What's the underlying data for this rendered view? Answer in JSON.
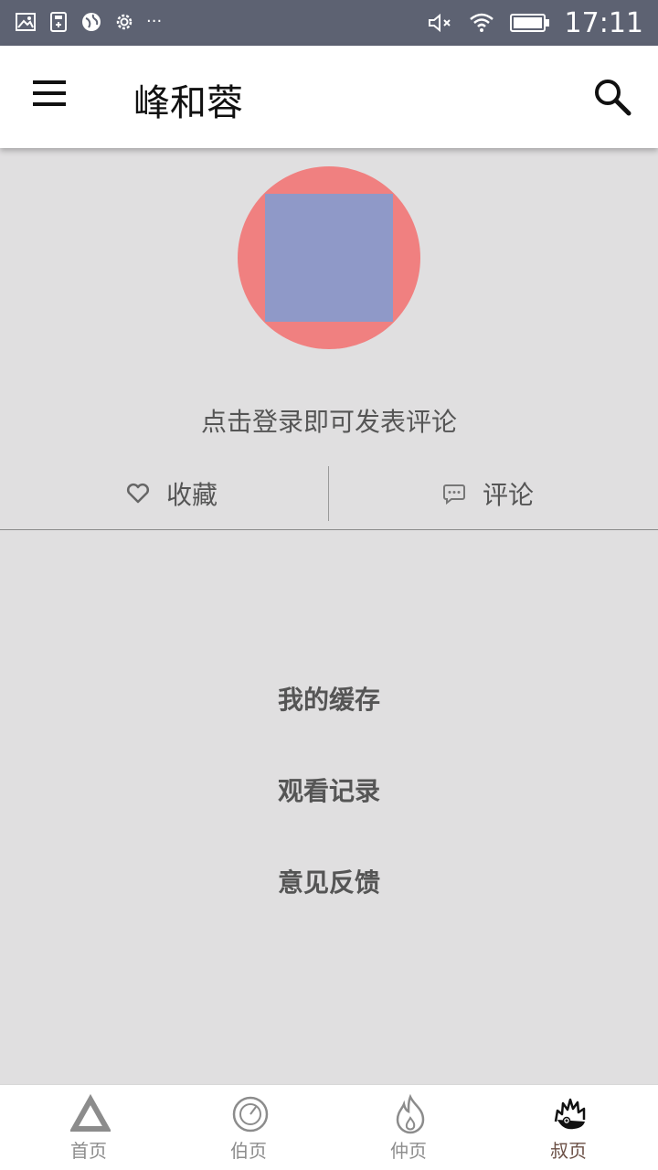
{
  "status_bar": {
    "time": "17:11",
    "left_icons": [
      "image-icon",
      "usb-icon",
      "globe-icon",
      "settings-icon"
    ],
    "overflow": "···",
    "right_icons": [
      "mute-icon",
      "wifi-icon",
      "battery-icon"
    ]
  },
  "app_bar": {
    "title": "峰和蓉",
    "menu_icon": "menu-icon",
    "search_icon": "search-icon"
  },
  "profile": {
    "login_prompt": "点击登录即可发表评论"
  },
  "actions": {
    "favorite_label": "收藏",
    "comment_label": "评论"
  },
  "menu": {
    "items": [
      "我的缓存",
      "观看记录",
      "意见反馈"
    ]
  },
  "bottom_nav": {
    "tabs": [
      {
        "label": "首页",
        "icon": "triangle-icon"
      },
      {
        "label": "伯页",
        "icon": "compass-icon"
      },
      {
        "label": "仲页",
        "icon": "flame-icon"
      },
      {
        "label": "叔页",
        "icon": "hedgehog-icon",
        "active": true
      }
    ]
  },
  "colors": {
    "status_bar": "#5d6272",
    "background": "#e0dfe0",
    "avatar_outer": "#f08080",
    "avatar_inner": "#8f99c8",
    "active_tab": "#6b4f45"
  }
}
